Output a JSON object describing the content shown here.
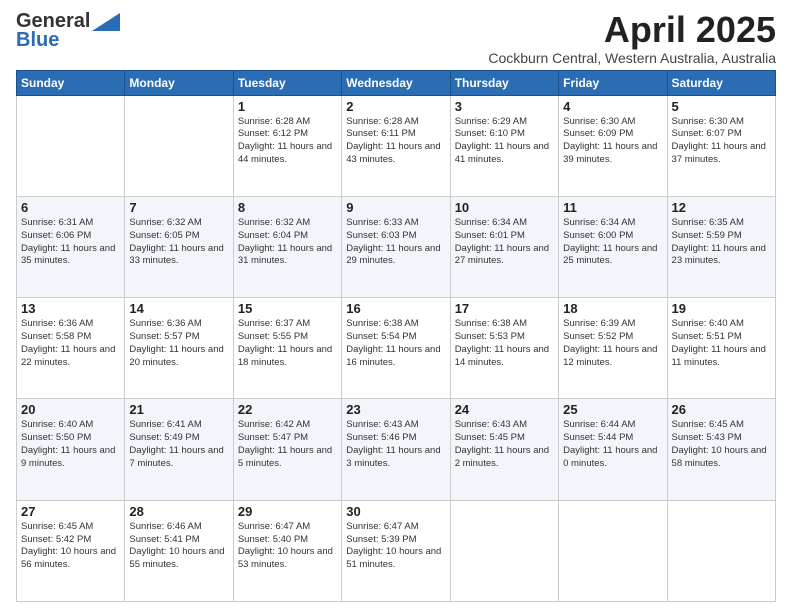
{
  "logo": {
    "line1": "General",
    "line2": "Blue"
  },
  "title": "April 2025",
  "subtitle": "Cockburn Central, Western Australia, Australia",
  "days_of_week": [
    "Sunday",
    "Monday",
    "Tuesday",
    "Wednesday",
    "Thursday",
    "Friday",
    "Saturday"
  ],
  "weeks": [
    [
      {
        "day": "",
        "info": ""
      },
      {
        "day": "",
        "info": ""
      },
      {
        "day": "1",
        "info": "Sunrise: 6:28 AM\nSunset: 6:12 PM\nDaylight: 11 hours and 44 minutes."
      },
      {
        "day": "2",
        "info": "Sunrise: 6:28 AM\nSunset: 6:11 PM\nDaylight: 11 hours and 43 minutes."
      },
      {
        "day": "3",
        "info": "Sunrise: 6:29 AM\nSunset: 6:10 PM\nDaylight: 11 hours and 41 minutes."
      },
      {
        "day": "4",
        "info": "Sunrise: 6:30 AM\nSunset: 6:09 PM\nDaylight: 11 hours and 39 minutes."
      },
      {
        "day": "5",
        "info": "Sunrise: 6:30 AM\nSunset: 6:07 PM\nDaylight: 11 hours and 37 minutes."
      }
    ],
    [
      {
        "day": "6",
        "info": "Sunrise: 6:31 AM\nSunset: 6:06 PM\nDaylight: 11 hours and 35 minutes."
      },
      {
        "day": "7",
        "info": "Sunrise: 6:32 AM\nSunset: 6:05 PM\nDaylight: 11 hours and 33 minutes."
      },
      {
        "day": "8",
        "info": "Sunrise: 6:32 AM\nSunset: 6:04 PM\nDaylight: 11 hours and 31 minutes."
      },
      {
        "day": "9",
        "info": "Sunrise: 6:33 AM\nSunset: 6:03 PM\nDaylight: 11 hours and 29 minutes."
      },
      {
        "day": "10",
        "info": "Sunrise: 6:34 AM\nSunset: 6:01 PM\nDaylight: 11 hours and 27 minutes."
      },
      {
        "day": "11",
        "info": "Sunrise: 6:34 AM\nSunset: 6:00 PM\nDaylight: 11 hours and 25 minutes."
      },
      {
        "day": "12",
        "info": "Sunrise: 6:35 AM\nSunset: 5:59 PM\nDaylight: 11 hours and 23 minutes."
      }
    ],
    [
      {
        "day": "13",
        "info": "Sunrise: 6:36 AM\nSunset: 5:58 PM\nDaylight: 11 hours and 22 minutes."
      },
      {
        "day": "14",
        "info": "Sunrise: 6:36 AM\nSunset: 5:57 PM\nDaylight: 11 hours and 20 minutes."
      },
      {
        "day": "15",
        "info": "Sunrise: 6:37 AM\nSunset: 5:55 PM\nDaylight: 11 hours and 18 minutes."
      },
      {
        "day": "16",
        "info": "Sunrise: 6:38 AM\nSunset: 5:54 PM\nDaylight: 11 hours and 16 minutes."
      },
      {
        "day": "17",
        "info": "Sunrise: 6:38 AM\nSunset: 5:53 PM\nDaylight: 11 hours and 14 minutes."
      },
      {
        "day": "18",
        "info": "Sunrise: 6:39 AM\nSunset: 5:52 PM\nDaylight: 11 hours and 12 minutes."
      },
      {
        "day": "19",
        "info": "Sunrise: 6:40 AM\nSunset: 5:51 PM\nDaylight: 11 hours and 11 minutes."
      }
    ],
    [
      {
        "day": "20",
        "info": "Sunrise: 6:40 AM\nSunset: 5:50 PM\nDaylight: 11 hours and 9 minutes."
      },
      {
        "day": "21",
        "info": "Sunrise: 6:41 AM\nSunset: 5:49 PM\nDaylight: 11 hours and 7 minutes."
      },
      {
        "day": "22",
        "info": "Sunrise: 6:42 AM\nSunset: 5:47 PM\nDaylight: 11 hours and 5 minutes."
      },
      {
        "day": "23",
        "info": "Sunrise: 6:43 AM\nSunset: 5:46 PM\nDaylight: 11 hours and 3 minutes."
      },
      {
        "day": "24",
        "info": "Sunrise: 6:43 AM\nSunset: 5:45 PM\nDaylight: 11 hours and 2 minutes."
      },
      {
        "day": "25",
        "info": "Sunrise: 6:44 AM\nSunset: 5:44 PM\nDaylight: 11 hours and 0 minutes."
      },
      {
        "day": "26",
        "info": "Sunrise: 6:45 AM\nSunset: 5:43 PM\nDaylight: 10 hours and 58 minutes."
      }
    ],
    [
      {
        "day": "27",
        "info": "Sunrise: 6:45 AM\nSunset: 5:42 PM\nDaylight: 10 hours and 56 minutes."
      },
      {
        "day": "28",
        "info": "Sunrise: 6:46 AM\nSunset: 5:41 PM\nDaylight: 10 hours and 55 minutes."
      },
      {
        "day": "29",
        "info": "Sunrise: 6:47 AM\nSunset: 5:40 PM\nDaylight: 10 hours and 53 minutes."
      },
      {
        "day": "30",
        "info": "Sunrise: 6:47 AM\nSunset: 5:39 PM\nDaylight: 10 hours and 51 minutes."
      },
      {
        "day": "",
        "info": ""
      },
      {
        "day": "",
        "info": ""
      },
      {
        "day": "",
        "info": ""
      }
    ]
  ]
}
